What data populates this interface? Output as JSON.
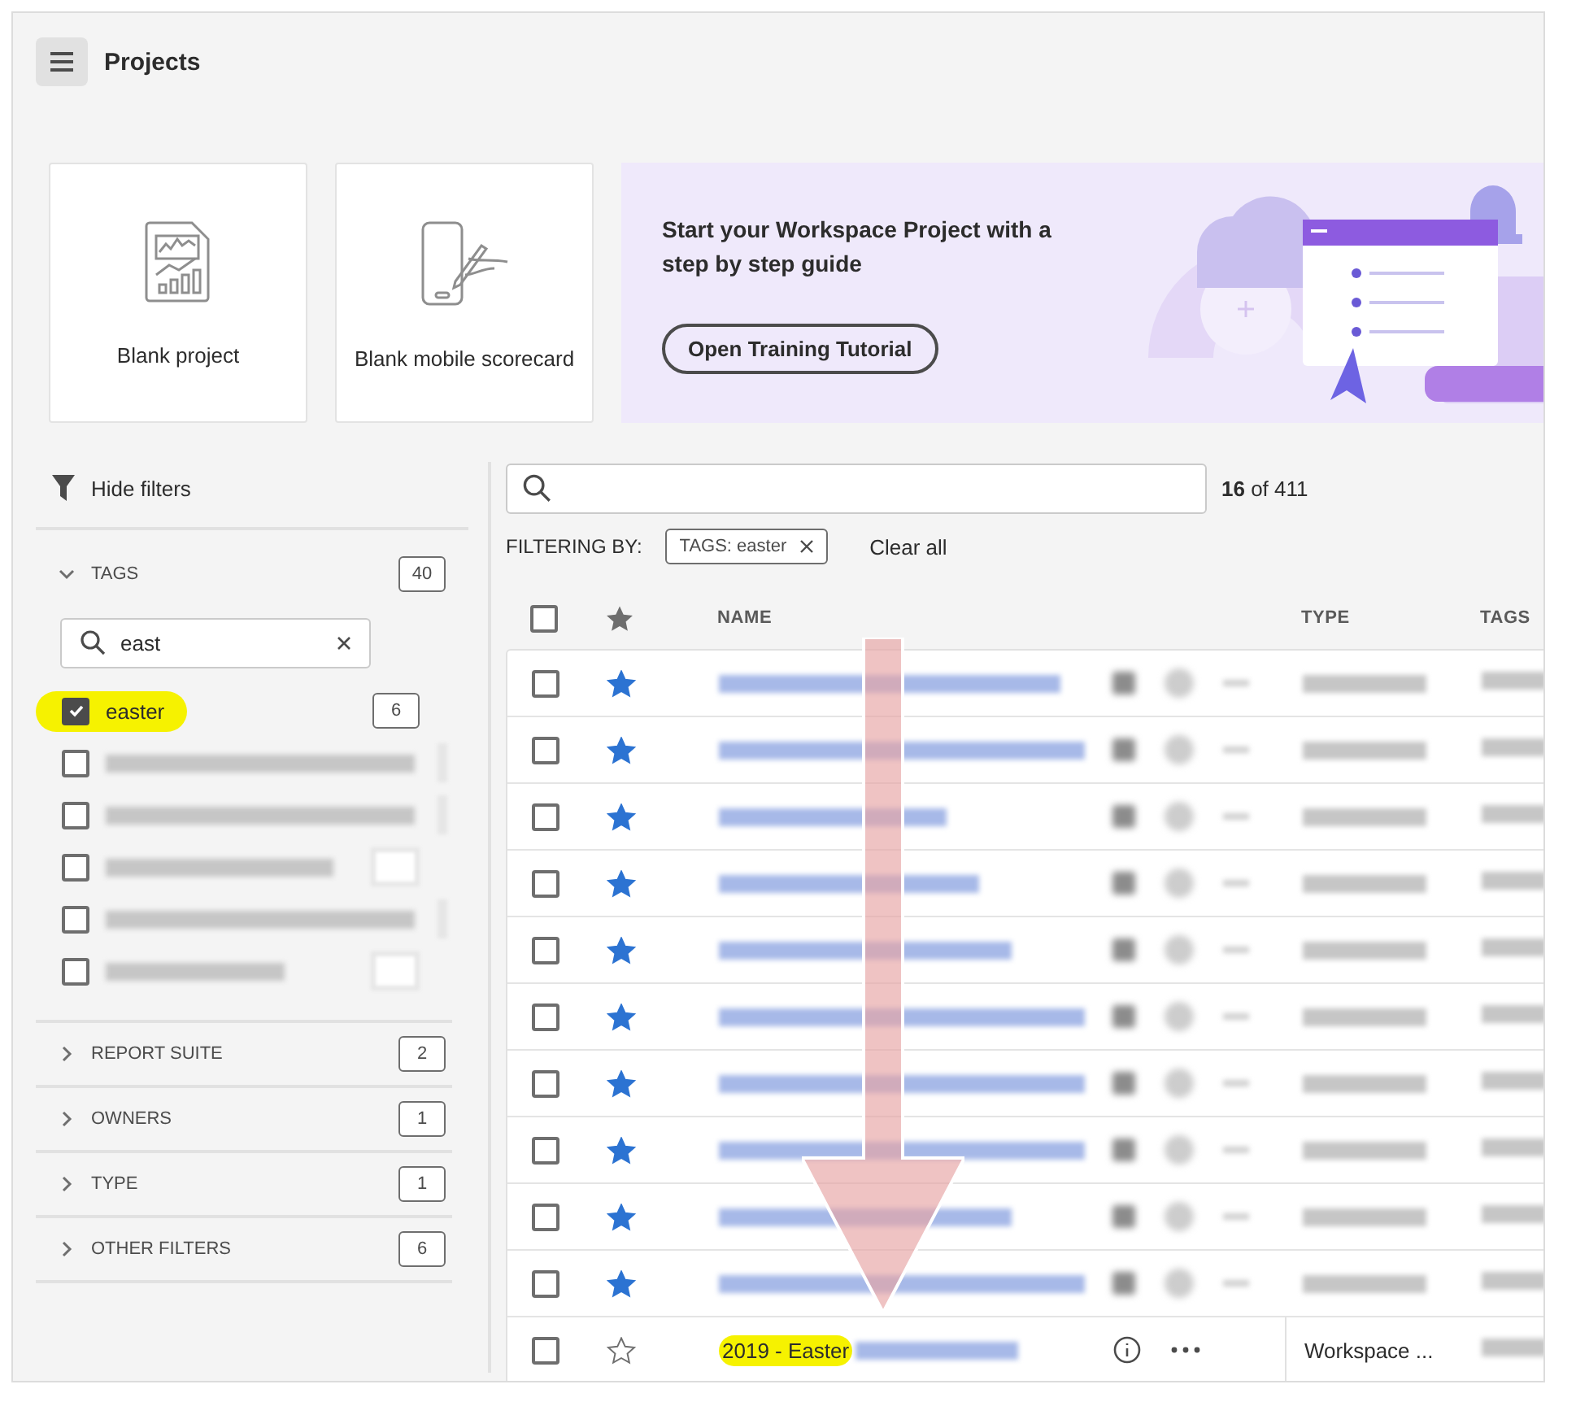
{
  "header": {
    "title": "Projects"
  },
  "templates": [
    {
      "kind": "report",
      "label": "Blank project"
    },
    {
      "kind": "mobile",
      "label": "Blank mobile scorecard"
    }
  ],
  "banner": {
    "heading": "Start your Workspace Project with a step by step guide",
    "button": "Open Training Tutorial"
  },
  "filters": {
    "toggle": "Hide filters",
    "sections": [
      {
        "label": "TAGS",
        "count": "40",
        "expanded": true,
        "search": {
          "value": "east"
        },
        "items": [
          {
            "label": "easter",
            "count": "6",
            "checked": true,
            "highlighted": true
          },
          {
            "checked": false
          },
          {
            "checked": false
          },
          {
            "checked": false
          },
          {
            "checked": false
          },
          {
            "checked": false
          }
        ]
      },
      {
        "label": "REPORT SUITE",
        "count": "2",
        "expanded": false
      },
      {
        "label": "OWNERS",
        "count": "1",
        "expanded": false
      },
      {
        "label": "TYPE",
        "count": "1",
        "expanded": false
      },
      {
        "label": "OTHER FILTERS",
        "count": "6",
        "expanded": false
      }
    ]
  },
  "search": {
    "results": "**16** of 411"
  },
  "filtering": {
    "label": "FILTERING BY:",
    "chips": [
      "TAGS: easter"
    ],
    "clear": "Clear all"
  },
  "table": {
    "columns": [
      "NAME",
      "TYPE",
      "TAGS"
    ],
    "all_selected": false,
    "rows": [
      {
        "favorite": true,
        "selected": false
      },
      {
        "favorite": true,
        "selected": false
      },
      {
        "favorite": true,
        "selected": false
      },
      {
        "favorite": true,
        "selected": false
      },
      {
        "favorite": true,
        "selected": false
      },
      {
        "favorite": true,
        "selected": false
      },
      {
        "favorite": true,
        "selected": false
      },
      {
        "favorite": true,
        "selected": false
      },
      {
        "favorite": true,
        "selected": false
      },
      {
        "favorite": true,
        "selected": false
      },
      {
        "favorite": false,
        "selected": false,
        "name": "2019 - Easter",
        "highlighted": true,
        "type": "Workspace ..."
      }
    ]
  }
}
